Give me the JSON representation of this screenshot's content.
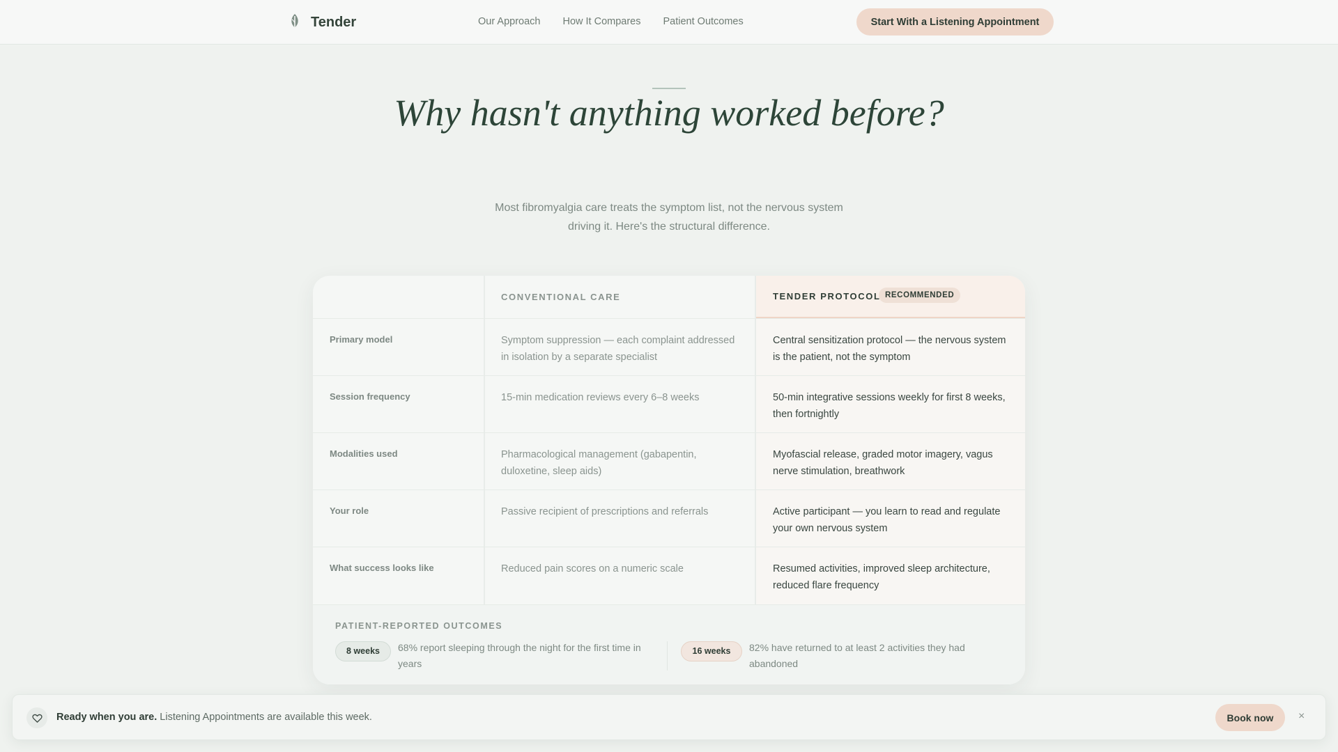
{
  "nav": {
    "brand": "Tender",
    "links": [
      "Our Approach",
      "How It Compares",
      "Patient Outcomes"
    ],
    "cta": "Start With a Listening Appointment"
  },
  "hero": {
    "title": "Why hasn't anything worked before?",
    "subtitle": "Most fibromyalgia care treats the symptom list, not the nervous system driving it. Here's the structural difference."
  },
  "comparison": {
    "col_conventional": "CONVENTIONAL CARE",
    "col_tender": "TENDER PROTOCOL",
    "badge": "RECOMMENDED",
    "rows": [
      {
        "label": "Primary model",
        "conventional": "Symptom suppression — each complaint addressed in isolation by a separate specialist",
        "tender": "Central sensitization protocol — the nervous system is the patient, not the symptom"
      },
      {
        "label": "Session frequency",
        "conventional": "15-min medication reviews every 6–8 weeks",
        "tender": "50-min integrative sessions weekly for first 8 weeks, then fortnightly"
      },
      {
        "label": "Modalities used",
        "conventional": "Pharmacological management (gabapentin, duloxetine, sleep aids)",
        "tender": "Myofascial release, graded motor imagery, vagus nerve stimulation, breathwork"
      },
      {
        "label": "Your role",
        "conventional": "Passive recipient of prescriptions and referrals",
        "tender": "Active participant — you learn to read and regulate your own nervous system"
      },
      {
        "label": "What success looks like",
        "conventional": "Reduced pain scores on a numeric scale",
        "tender": "Resumed activities, improved sleep architecture, reduced flare frequency"
      }
    ],
    "outcomes": {
      "title": "PATIENT-REPORTED OUTCOMES",
      "items": [
        {
          "badge": "8 weeks",
          "text": "68% report sleeping through the night for the first time in years"
        },
        {
          "badge": "16 weeks",
          "text": "82% have returned to at least 2 activities they had abandoned"
        }
      ]
    }
  },
  "banner": {
    "bold": "Ready when you are.",
    "text": " Listening Appointments are available this week.",
    "button": "Book now",
    "close": "×"
  },
  "colors": {
    "accent": "#efd8cb",
    "heading": "#2d4538",
    "background": "#eff2ef"
  },
  "icons": {
    "brand": "leaf-logo-icon",
    "banner": "heart-icon",
    "close": "close-icon"
  }
}
